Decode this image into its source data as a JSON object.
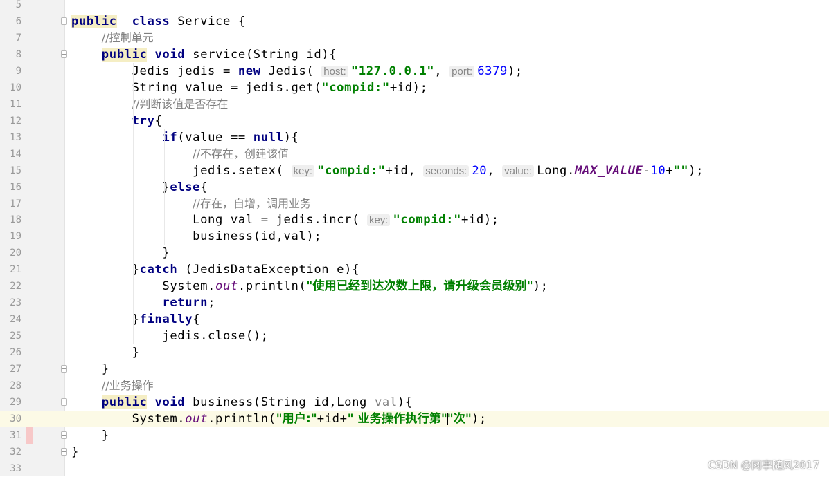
{
  "editor": {
    "current_line": 30,
    "lines": [
      {
        "n": "5",
        "fold": false,
        "tokens": []
      },
      {
        "n": "6",
        "fold": true,
        "tokens": [
          [
            "kw kw-hl",
            "public"
          ],
          [
            "",
            "  "
          ],
          [
            "kw",
            "class"
          ],
          [
            "",
            " Service {"
          ]
        ]
      },
      {
        "n": "7",
        "fold": false,
        "tokens": [
          [
            "",
            "    "
          ],
          [
            "comment",
            "//控制单元"
          ]
        ]
      },
      {
        "n": "8",
        "fold": true,
        "tokens": [
          [
            "",
            "    "
          ],
          [
            "kw kw-hl",
            "public"
          ],
          [
            "",
            " "
          ],
          [
            "kw",
            "void"
          ],
          [
            "",
            " service(String id){"
          ]
        ]
      },
      {
        "n": "9",
        "fold": false,
        "tokens": [
          [
            "",
            "        Jedis jedis = "
          ],
          [
            "kw",
            "new"
          ],
          [
            "",
            " Jedis( "
          ],
          [
            "hint",
            "host:"
          ],
          [
            "str",
            "\"127.0.0.1\""
          ],
          [
            "",
            ", "
          ],
          [
            "hint",
            "port:"
          ],
          [
            "num",
            "6379"
          ],
          [
            "",
            ");"
          ]
        ]
      },
      {
        "n": "10",
        "fold": false,
        "tokens": [
          [
            "",
            "        String value = jedis.get("
          ],
          [
            "str",
            "\"compid:\""
          ],
          [
            "",
            "+id);"
          ]
        ]
      },
      {
        "n": "11",
        "fold": false,
        "tokens": [
          [
            "",
            "        "
          ],
          [
            "comment",
            "//判断该值是否存在"
          ]
        ]
      },
      {
        "n": "12",
        "fold": false,
        "tokens": [
          [
            "",
            "        "
          ],
          [
            "kw",
            "try"
          ],
          [
            "",
            "{"
          ]
        ]
      },
      {
        "n": "13",
        "fold": false,
        "tokens": [
          [
            "",
            "            "
          ],
          [
            "kw",
            "if"
          ],
          [
            "",
            "(value == "
          ],
          [
            "kw",
            "null"
          ],
          [
            "",
            "){"
          ]
        ]
      },
      {
        "n": "14",
        "fold": false,
        "tokens": [
          [
            "",
            "                "
          ],
          [
            "comment",
            "//不存在，创建该值"
          ]
        ]
      },
      {
        "n": "15",
        "fold": false,
        "tokens": [
          [
            "",
            "                jedis.setex( "
          ],
          [
            "hint",
            "key:"
          ],
          [
            "str",
            "\"compid:\""
          ],
          [
            "",
            "+id, "
          ],
          [
            "hint",
            "seconds:"
          ],
          [
            "num",
            "20"
          ],
          [
            "",
            ", "
          ],
          [
            "hint",
            "value:"
          ],
          [
            "",
            "Long."
          ],
          [
            "field",
            "MAX_VALUE"
          ],
          [
            "",
            "-"
          ],
          [
            "num",
            "10"
          ],
          [
            "",
            "+"
          ],
          [
            "str",
            "\"\""
          ],
          [
            "",
            ");"
          ]
        ]
      },
      {
        "n": "16",
        "fold": false,
        "tokens": [
          [
            "",
            "            }"
          ],
          [
            "kw",
            "else"
          ],
          [
            "",
            "{"
          ]
        ]
      },
      {
        "n": "17",
        "fold": false,
        "tokens": [
          [
            "",
            "                "
          ],
          [
            "comment",
            "//存在，自增，调用业务"
          ]
        ]
      },
      {
        "n": "18",
        "fold": false,
        "tokens": [
          [
            "",
            "                Long val = jedis.incr( "
          ],
          [
            "hint",
            "key:"
          ],
          [
            "str",
            "\"compid:\""
          ],
          [
            "",
            "+id);"
          ]
        ]
      },
      {
        "n": "19",
        "fold": false,
        "tokens": [
          [
            "",
            "                business(id,val);"
          ]
        ]
      },
      {
        "n": "20",
        "fold": false,
        "tokens": [
          [
            "",
            "            }"
          ]
        ]
      },
      {
        "n": "21",
        "fold": false,
        "tokens": [
          [
            "",
            "        }"
          ],
          [
            "kw",
            "catch"
          ],
          [
            "",
            " (JedisDataException e){"
          ]
        ]
      },
      {
        "n": "22",
        "fold": false,
        "tokens": [
          [
            "",
            "            System."
          ],
          [
            "out",
            "out"
          ],
          [
            "",
            ".println("
          ],
          [
            "str cjk",
            "\"使用已经到达次数上限，请升级会员级别\""
          ],
          [
            "",
            ");"
          ]
        ]
      },
      {
        "n": "23",
        "fold": false,
        "tokens": [
          [
            "",
            "            "
          ],
          [
            "kw",
            "return"
          ],
          [
            "",
            ";"
          ]
        ]
      },
      {
        "n": "24",
        "fold": false,
        "tokens": [
          [
            "",
            "        }"
          ],
          [
            "kw",
            "finally"
          ],
          [
            "",
            "{"
          ]
        ]
      },
      {
        "n": "25",
        "fold": false,
        "tokens": [
          [
            "",
            "            jedis.close();"
          ]
        ]
      },
      {
        "n": "26",
        "fold": false,
        "tokens": [
          [
            "",
            "        }"
          ]
        ]
      },
      {
        "n": "27",
        "fold": true,
        "tokens": [
          [
            "",
            "    }"
          ]
        ]
      },
      {
        "n": "28",
        "fold": false,
        "tokens": [
          [
            "",
            "    "
          ],
          [
            "comment",
            "//业务操作"
          ]
        ]
      },
      {
        "n": "29",
        "fold": true,
        "tokens": [
          [
            "",
            "    "
          ],
          [
            "kw kw-hl",
            "public"
          ],
          [
            "",
            " "
          ],
          [
            "kw",
            "void"
          ],
          [
            "",
            " business(String id,Long "
          ],
          [
            "unused",
            "val"
          ],
          [
            "",
            "){"
          ]
        ]
      },
      {
        "n": "30",
        "fold": false,
        "tokens": [
          [
            "",
            "        System."
          ],
          [
            "out",
            "out"
          ],
          [
            "",
            ".println("
          ],
          [
            "str cjk",
            "\"用户:\""
          ],
          [
            "",
            "+id+"
          ],
          [
            "str cjk",
            "\" 业务操作执行第\""
          ],
          [
            "caret",
            ""
          ],
          [
            "str cjk",
            "\"次\""
          ],
          [
            "",
            ");"
          ]
        ]
      },
      {
        "n": "31",
        "fold": true,
        "tokens": [
          [
            "",
            "    }"
          ]
        ]
      },
      {
        "n": "32",
        "fold": true,
        "tokens": [
          [
            "",
            "}"
          ]
        ]
      },
      {
        "n": "33",
        "fold": false,
        "tokens": []
      }
    ]
  },
  "watermark": "CSDN @网事随风2017"
}
